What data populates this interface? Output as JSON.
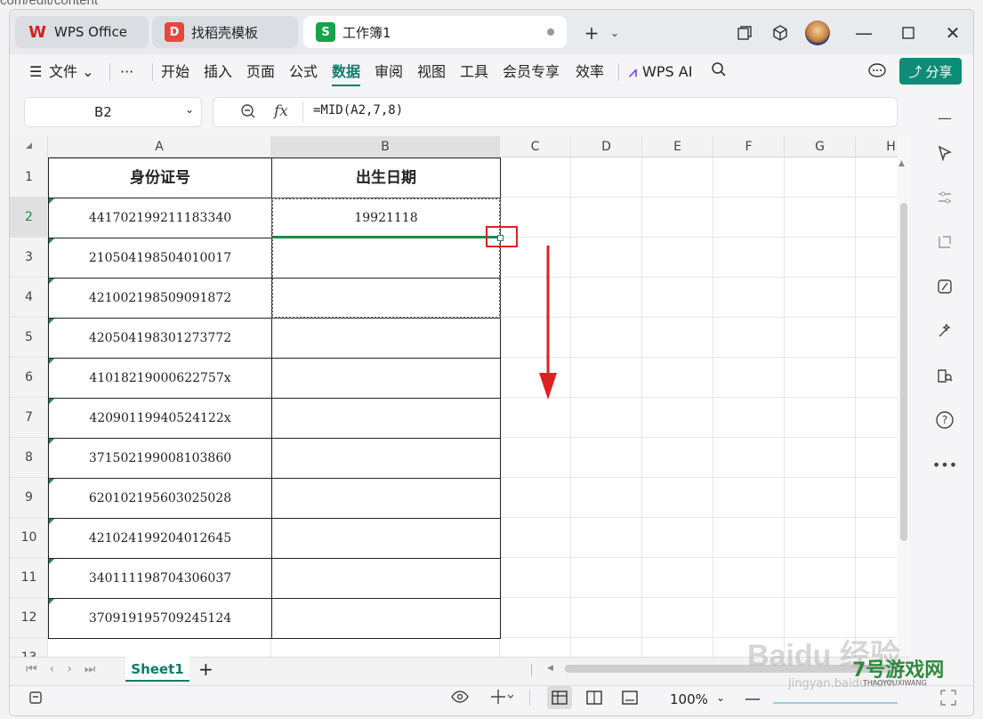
{
  "background": {
    "url_fragment": "com/edit/content"
  },
  "tabs": [
    {
      "label": "WPS Office",
      "icon": "wps-logo-icon",
      "color": "#d9201f"
    },
    {
      "label": "找稻壳模板",
      "icon": "docer-logo-icon",
      "color": "#e8453c"
    },
    {
      "label": "工作簿1",
      "icon": "spreadsheet-s-icon",
      "color": "#16a34a",
      "active": true
    }
  ],
  "menu": {
    "file": "文件",
    "items": [
      "开始",
      "插入",
      "页面",
      "公式",
      "数据",
      "审阅",
      "视图",
      "工具",
      "会员专享",
      "效率"
    ],
    "active": "数据",
    "wps_ai": "WPS AI",
    "share": "分享"
  },
  "formula_bar": {
    "cell_ref": "B2",
    "fx": "fx",
    "formula": "=MID(A2,7,8)"
  },
  "columns": [
    "A",
    "B",
    "C",
    "D",
    "E",
    "F",
    "G",
    "H"
  ],
  "rows": [
    "1",
    "2",
    "3",
    "4",
    "5",
    "6",
    "7",
    "8",
    "9",
    "10",
    "11",
    "12",
    "13"
  ],
  "table": {
    "headers": [
      "身份证号",
      "出生日期"
    ],
    "ids": [
      "441702199211183340",
      "210504198504010017",
      "421002198509091872",
      "420504198301273772",
      "41018219000622757x",
      "42090119940524122x",
      "371502199008103860",
      "620102195603025028",
      "421024199204012645",
      "340111198704306037",
      "370919195709245124"
    ],
    "b_values": [
      "19921118"
    ]
  },
  "sheet": {
    "name": "Sheet1"
  },
  "status": {
    "zoom": "100%"
  },
  "colors": {
    "accent": "#0f7b6c",
    "arrow": "#e02020",
    "select_green": "#1a8a4a"
  },
  "watermark": {
    "brand": "Baidu 经验",
    "sub": "jingyan.baidu.com",
    "site": "7号游戏网",
    "site_en": "THAOYOUXIWANG"
  }
}
